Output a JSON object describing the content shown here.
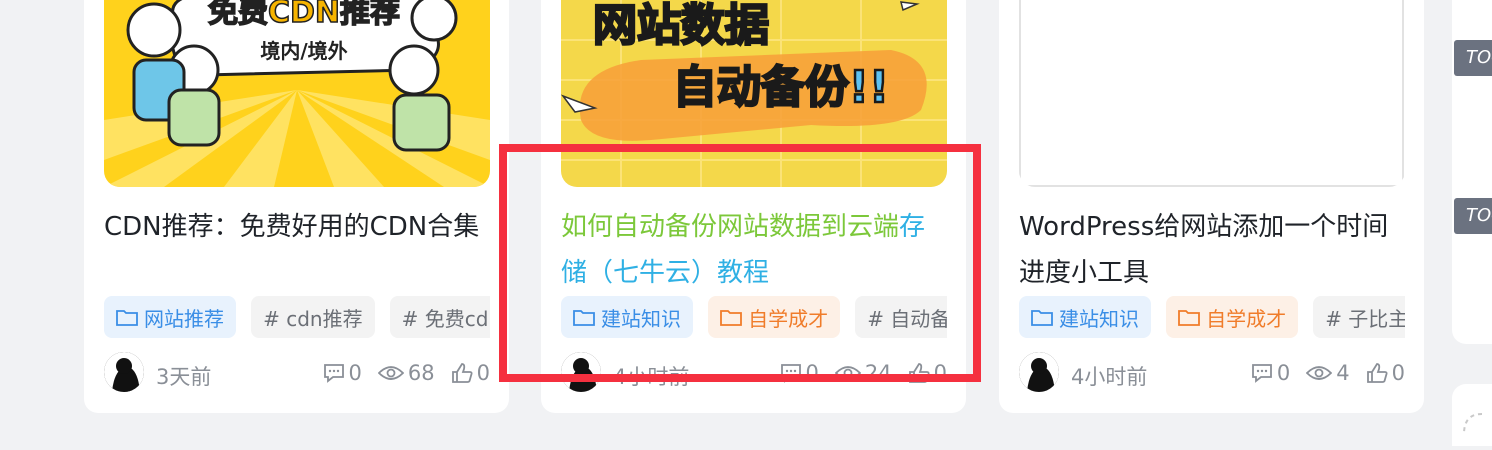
{
  "cards": [
    {
      "thumb_text": [
        "免费CDN推荐",
        "境内/境外"
      ],
      "title": "CDN推荐：免费好用的CDN合集",
      "tags": [
        "网站推荐",
        "# cdn推荐",
        "# 免费cdn"
      ],
      "time": "3天前",
      "comments": "0",
      "views": "68",
      "likes": "0"
    },
    {
      "thumb_text": [
        "网站数据",
        "自动备份!!"
      ],
      "title_part1": "如何自动备份网站数据到云端",
      "title_part2": "存储（七牛云）教程",
      "tags": [
        "建站知识",
        "自学成才",
        "# 自动备份"
      ],
      "time": "4小时前",
      "comments": "0",
      "views": "24",
      "likes": "0"
    },
    {
      "title": "WordPress给网站添加一个时间进度小工具",
      "tags": [
        "建站知识",
        "自学成才",
        "# 子比主题"
      ],
      "time": "4小时前",
      "comments": "0",
      "views": "4",
      "likes": "0"
    }
  ],
  "sidebar": {
    "toc_label": "TOC"
  },
  "colors": {
    "highlight": "#f5303f",
    "category_tag": "#3a8ee6",
    "orange_tag": "#f07c2a"
  }
}
